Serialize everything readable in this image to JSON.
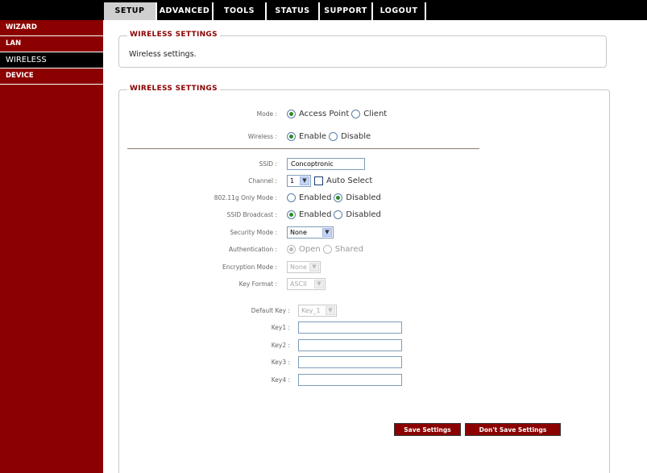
{
  "nav": {
    "tabs": [
      {
        "label": "SETUP",
        "active": true
      },
      {
        "label": "ADVANCED",
        "active": false
      },
      {
        "label": "TOOLS",
        "active": false
      },
      {
        "label": "STATUS",
        "active": false
      },
      {
        "label": "SUPPORT",
        "active": false
      },
      {
        "label": "LOGOUT",
        "active": false
      }
    ]
  },
  "sidebar": {
    "items": [
      {
        "label": "WIZARD",
        "active": false
      },
      {
        "label": "LAN",
        "active": false
      },
      {
        "label": "WIRELESS",
        "active": true
      },
      {
        "label": "DEVICE",
        "active": false
      }
    ]
  },
  "info_panel": {
    "legend": "WIRELESS SETTINGS",
    "description": "Wireless settings."
  },
  "settings": {
    "legend": "WIRELESS SETTINGS",
    "mode": {
      "label": "Mode :",
      "options": [
        "Access Point",
        "Client"
      ],
      "selected": "Access Point"
    },
    "wireless": {
      "label": "Wireless :",
      "options": [
        "Enable",
        "Disable"
      ],
      "selected": "Enable"
    },
    "ssid": {
      "label": "SSID :",
      "value": "Concoptronic"
    },
    "channel": {
      "label": "Channel :",
      "value": "1",
      "auto_select_label": "Auto Select",
      "auto_select": false
    },
    "g_only": {
      "label": "802.11g Only Mode :",
      "options": [
        "Enabled",
        "Disabled"
      ],
      "selected": "Disabled"
    },
    "ssid_broadcast": {
      "label": "SSID Broadcast :",
      "options": [
        "Enabled",
        "Disabled"
      ],
      "selected": "Enabled"
    },
    "security_mode": {
      "label": "Security Mode :",
      "value": "None"
    },
    "authentication": {
      "label": "Authentication :",
      "options": [
        "Open",
        "Shared"
      ],
      "selected": "Open"
    },
    "encryption_mode": {
      "label": "Encryption Mode :",
      "value": "None"
    },
    "key_format": {
      "label": "Key Format :",
      "value": "ASCII"
    },
    "default_key": {
      "label": "Default Key :",
      "value": "Key_1"
    },
    "keys": [
      {
        "label": "Key1 :",
        "value": ""
      },
      {
        "label": "Key2 :",
        "value": ""
      },
      {
        "label": "Key3 :",
        "value": ""
      },
      {
        "label": "Key4 :",
        "value": ""
      }
    ],
    "save_label": "Save Settings",
    "dont_save_label": "Don't Save Settings"
  },
  "colors": {
    "brand_red": "#8b0000",
    "nav_black": "#000000",
    "active_tab": "#cfcfcf",
    "radio_dot": "#2a8a2a"
  }
}
